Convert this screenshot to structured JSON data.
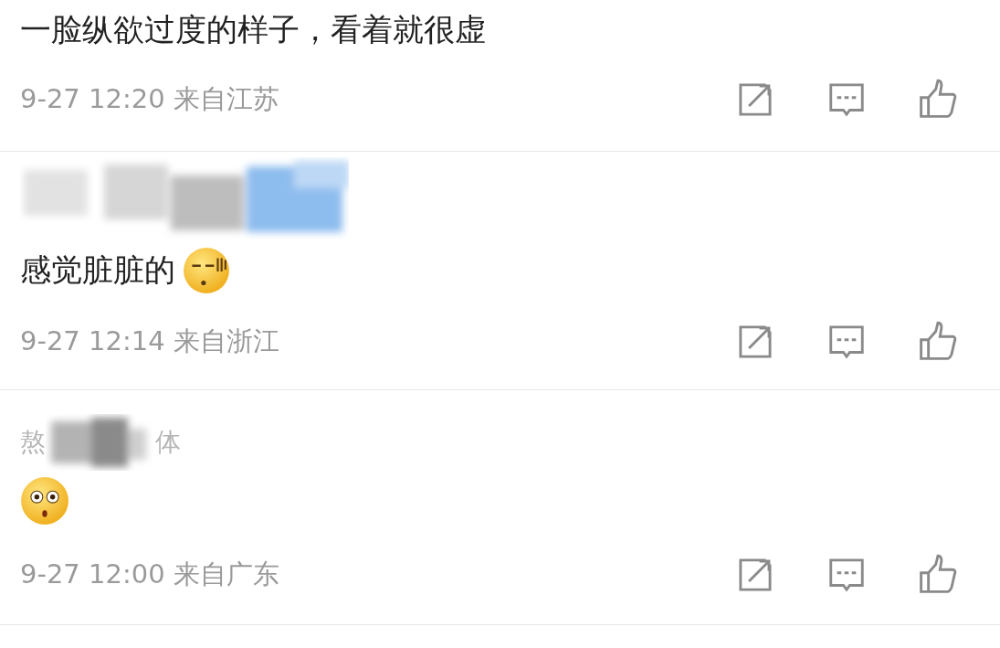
{
  "comments": [
    {
      "text": "一脸纵欲过度的样子，看着就很虚",
      "time": "9-27 12:20",
      "location": "来自江苏"
    },
    {
      "username": {
        "kind": "redacted"
      },
      "text": "感觉脏脏的",
      "emoji": {
        "kind": "sleepy"
      },
      "time": "9-27 12:14",
      "location": "来自浙江"
    },
    {
      "username": {
        "kind": "partial",
        "before": "熬",
        "after": "体"
      },
      "emoji": {
        "kind": "shocked"
      },
      "time": "9-27 12:00",
      "location": "来自广东"
    }
  ]
}
